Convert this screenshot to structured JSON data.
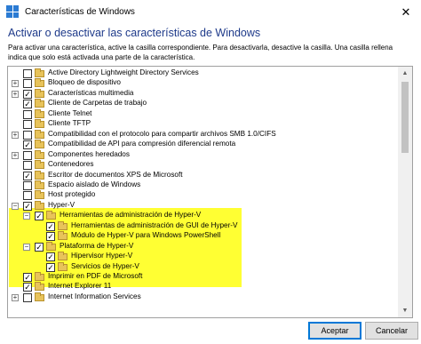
{
  "window": {
    "title": "Características de Windows",
    "close_glyph": "✕"
  },
  "heading": "Activar o desactivar las características de Windows",
  "description": "Para activar una característica, active la casilla correspondiente. Para desactivarla, desactive la casilla. Una casilla rellena indica que solo está activada una parte de la característica.",
  "features": [
    {
      "label": "Active Directory Lightweight Directory Services",
      "level": 0,
      "expandable": false,
      "expand_glyph": "",
      "state": "unchecked",
      "check_glyph": ""
    },
    {
      "label": "Bloqueo de dispositivo",
      "level": 0,
      "expandable": true,
      "expand_glyph": "+",
      "state": "unchecked",
      "check_glyph": ""
    },
    {
      "label": "Características multimedia",
      "level": 0,
      "expandable": true,
      "expand_glyph": "+",
      "state": "checked",
      "check_glyph": "✓"
    },
    {
      "label": "Cliente de Carpetas de trabajo",
      "level": 0,
      "expandable": false,
      "expand_glyph": "",
      "state": "checked",
      "check_glyph": "✓"
    },
    {
      "label": "Cliente Telnet",
      "level": 0,
      "expandable": false,
      "expand_glyph": "",
      "state": "unchecked",
      "check_glyph": ""
    },
    {
      "label": "Cliente TFTP",
      "level": 0,
      "expandable": false,
      "expand_glyph": "",
      "state": "unchecked",
      "check_glyph": ""
    },
    {
      "label": "Compatibilidad con el protocolo para compartir archivos SMB 1.0/CIFS",
      "level": 0,
      "expandable": true,
      "expand_glyph": "+",
      "state": "unchecked",
      "check_glyph": ""
    },
    {
      "label": "Compatibilidad de API para compresión diferencial remota",
      "level": 0,
      "expandable": false,
      "expand_glyph": "",
      "state": "checked",
      "check_glyph": "✓"
    },
    {
      "label": "Componentes heredados",
      "level": 0,
      "expandable": true,
      "expand_glyph": "+",
      "state": "unchecked",
      "check_glyph": ""
    },
    {
      "label": "Contenedores",
      "level": 0,
      "expandable": false,
      "expand_glyph": "",
      "state": "unchecked",
      "check_glyph": ""
    },
    {
      "label": "Escritor de documentos XPS de Microsoft",
      "level": 0,
      "expandable": false,
      "expand_glyph": "",
      "state": "checked",
      "check_glyph": "✓"
    },
    {
      "label": "Espacio aislado de Windows",
      "level": 0,
      "expandable": false,
      "expand_glyph": "",
      "state": "unchecked",
      "check_glyph": ""
    },
    {
      "label": "Host protegido",
      "level": 0,
      "expandable": false,
      "expand_glyph": "",
      "state": "unchecked",
      "check_glyph": ""
    },
    {
      "label": "Hyper-V",
      "level": 0,
      "expandable": true,
      "expand_glyph": "−",
      "state": "checked",
      "check_glyph": "✓"
    },
    {
      "label": "Herramientas de administración de Hyper-V",
      "level": 1,
      "expandable": true,
      "expand_glyph": "−",
      "state": "checked",
      "check_glyph": "✓"
    },
    {
      "label": "Herramientas de administración de GUI de Hyper-V",
      "level": 2,
      "expandable": false,
      "expand_glyph": "",
      "state": "checked",
      "check_glyph": "✓"
    },
    {
      "label": "Módulo de Hyper-V para Windows PowerShell",
      "level": 2,
      "expandable": false,
      "expand_glyph": "",
      "state": "checked",
      "check_glyph": "✓"
    },
    {
      "label": "Plataforma de Hyper-V",
      "level": 1,
      "expandable": true,
      "expand_glyph": "−",
      "state": "checked",
      "check_glyph": "✓"
    },
    {
      "label": "Hipervisor Hyper-V",
      "level": 2,
      "expandable": false,
      "expand_glyph": "",
      "state": "checked",
      "check_glyph": "✓"
    },
    {
      "label": "Servicios de Hyper-V",
      "level": 2,
      "expandable": false,
      "expand_glyph": "",
      "state": "checked",
      "check_glyph": "✓"
    },
    {
      "label": "Imprimir en PDF de Microsoft",
      "level": 0,
      "expandable": false,
      "expand_glyph": "",
      "state": "checked",
      "check_glyph": "✓"
    },
    {
      "label": "Internet Explorer 11",
      "level": 0,
      "expandable": false,
      "expand_glyph": "",
      "state": "checked",
      "check_glyph": "✓"
    },
    {
      "label": "Internet Information Services",
      "level": 0,
      "expandable": true,
      "expand_glyph": "+",
      "state": "unchecked",
      "check_glyph": ""
    }
  ],
  "scrollbar": {
    "up_glyph": "▲",
    "down_glyph": "▼"
  },
  "buttons": {
    "accept": "Aceptar",
    "cancel": "Cancelar"
  },
  "colors": {
    "highlight": "#ffff33",
    "heading": "#1e3a8a",
    "folder": "#e8c35a",
    "accent": "#0078d7"
  }
}
